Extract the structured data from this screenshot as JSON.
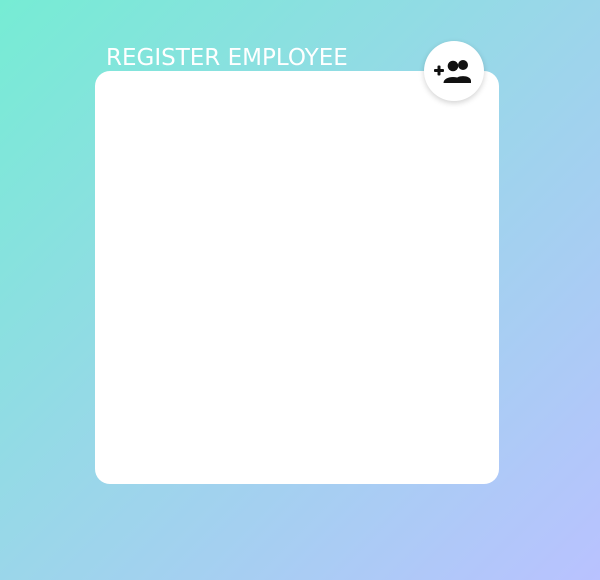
{
  "form": {
    "title": "REGISTER EMPLOYEE"
  },
  "icons": {
    "header_action": "add-group-icon"
  },
  "colors": {
    "gradient_start": "#76ecd4",
    "gradient_end": "#b9c2ff",
    "card": "#ffffff",
    "title_text": "#ffffff",
    "icon": "#111111"
  }
}
